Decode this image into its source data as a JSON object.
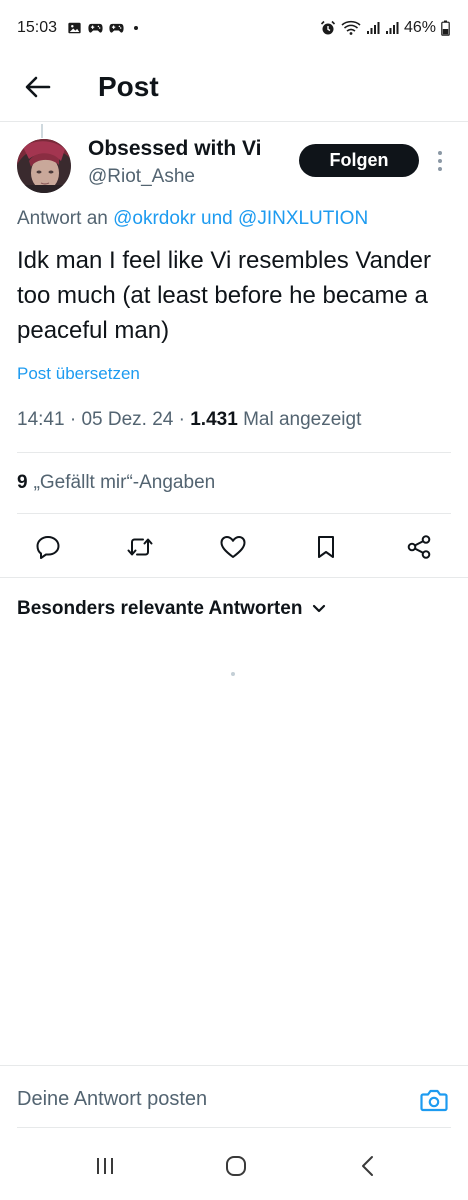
{
  "status_bar": {
    "time": "15:03",
    "battery": "46%",
    "icons": [
      "gallery-icon",
      "game-controller-icon",
      "game-controller-icon",
      "notification-dot",
      "alarm-icon",
      "wifi-icon",
      "signal-icon",
      "signal-icon",
      "battery-icon"
    ]
  },
  "header": {
    "title": "Post"
  },
  "post": {
    "author_name": "Obsessed with Vi",
    "author_handle": "@Riot_Ashe",
    "follow_label": "Folgen",
    "reply_prefix": "Antwort an",
    "reply_mention_1": "@okrdokr",
    "reply_joiner": "und",
    "reply_mention_2": "@JINXLUTION",
    "text": "Idk man I feel like Vi resembles Vander too much (at least before he became a peaceful man)",
    "translate_label": "Post übersetzen",
    "time": "14:41",
    "date": "05 Dez. 24",
    "view_count": "1.431",
    "view_label": "Mal angezeigt",
    "separator": "·",
    "likes_count": "9",
    "likes_label": "„Gefällt mir“-Angaben"
  },
  "actions": [
    "reply-icon",
    "repost-icon",
    "like-icon",
    "bookmark-icon",
    "share-icon"
  ],
  "replies": {
    "sort_label": "Besonders relevante Antworten"
  },
  "composer": {
    "placeholder": "Deine Antwort posten"
  },
  "colors": {
    "text": "#0f1419",
    "secondary": "#536471",
    "accent": "#1d9bf0",
    "divider": "#e7e9ea"
  }
}
